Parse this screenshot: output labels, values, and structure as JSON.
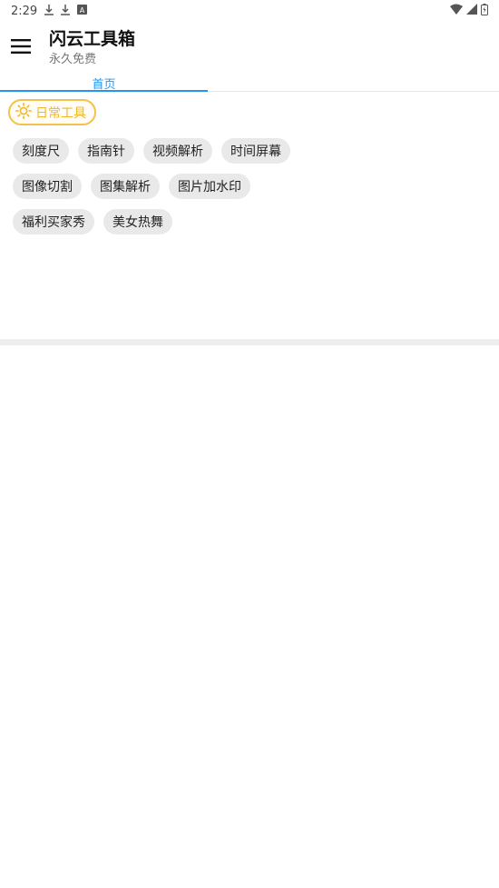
{
  "status": {
    "time": "2:29",
    "download_icon": "download-icon",
    "font_icon": "A"
  },
  "app": {
    "title": "闪云工具箱",
    "subtitle": "永久免费"
  },
  "tabs": [
    {
      "label": "首页"
    }
  ],
  "category": {
    "label": "日常工具",
    "icon": "sun-icon"
  },
  "tools": {
    "rows": [
      [
        "刻度尺",
        "指南针",
        "视频解析",
        "时间屏幕"
      ],
      [
        "图像切割",
        "图集解析",
        "图片加水印"
      ],
      [
        "福利买家秀",
        "美女热舞"
      ]
    ]
  },
  "colors": {
    "accent": "#2196f3",
    "category": "#f0b62a",
    "chip_bg": "#e9e9e9"
  }
}
